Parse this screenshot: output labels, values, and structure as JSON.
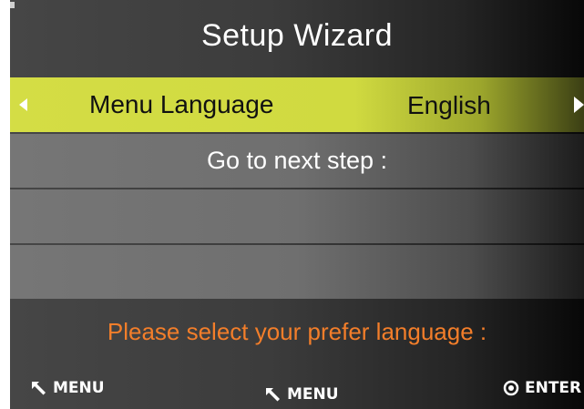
{
  "title": "Setup Wizard",
  "language_row": {
    "label": "Menu Language",
    "value": "English",
    "left_arrow_icon": "arrow-left-icon",
    "right_arrow_icon": "arrow-right-icon"
  },
  "next_step": {
    "label": "Go to next step :"
  },
  "prompt": "Please select your prefer language :",
  "footer": {
    "left_hint": {
      "icon": "back-arrow-icon",
      "label": "MENU"
    },
    "center_hint": {
      "icon": "back-arrow-icon",
      "label": "MENU"
    },
    "right_hint": {
      "icon": "enter-circle-icon",
      "label": "ENTER"
    }
  },
  "colors": {
    "highlight": "#d4dd45",
    "prompt": "#f37e2a",
    "row": "#767676"
  }
}
